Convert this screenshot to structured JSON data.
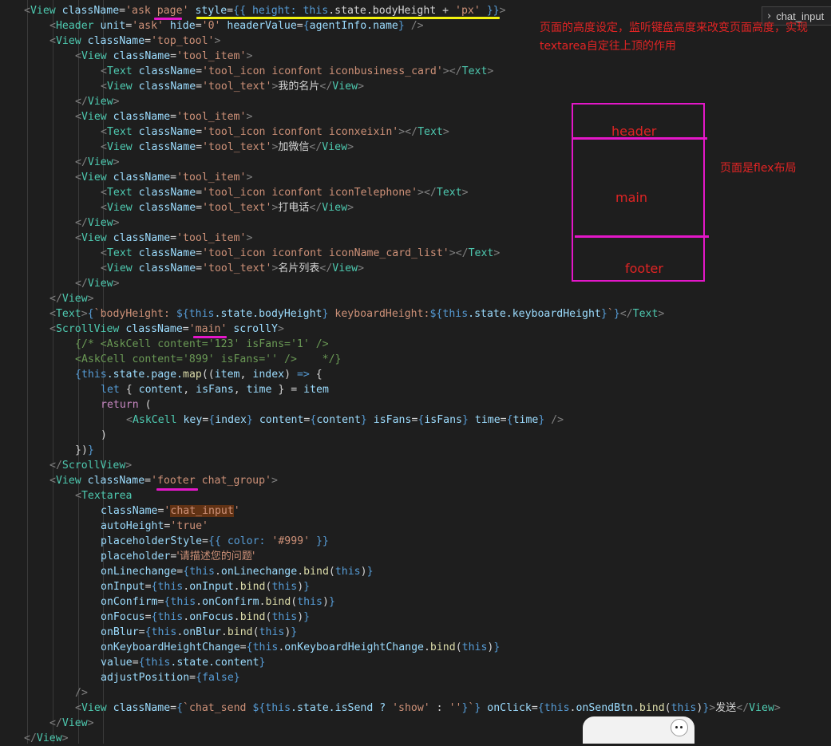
{
  "search_widget": {
    "chevron_icon": "chevron-right-icon",
    "query": "chat_input"
  },
  "code": {
    "l1": [
      "<",
      "View",
      " ",
      "className",
      "=",
      "'ask ",
      "page",
      "'",
      " ",
      "style",
      "=",
      "{{ height: ",
      "this",
      ".state.bodyHeight + ",
      "'px'",
      " }}",
      ">"
    ],
    "l2": [
      "<",
      "Header",
      " ",
      "unit",
      "=",
      "'ask'",
      " ",
      "hide",
      "=",
      "'0'",
      " ",
      "headerValue",
      "=",
      "{",
      "agentInfo.name",
      "}",
      " />"
    ],
    "l3": [
      "<",
      "View",
      " ",
      "className",
      "=",
      "'top_tool'",
      ">"
    ],
    "l4": [
      "<",
      "View",
      " ",
      "className",
      "=",
      "'tool_item'",
      ">"
    ],
    "l5": [
      "<",
      "Text",
      " ",
      "className",
      "=",
      "'tool_icon iconfont iconbusiness_card'",
      "></",
      "Text",
      ">"
    ],
    "l6": [
      "<",
      "View",
      " ",
      "className",
      "=",
      "'tool_text'",
      ">",
      "我的名片",
      "</",
      "View",
      ">"
    ],
    "l7": [
      "</",
      "View",
      ">"
    ],
    "l8": [
      "<",
      "View",
      " ",
      "className",
      "=",
      "'tool_item'",
      ">"
    ],
    "l9": [
      "<",
      "Text",
      " ",
      "className",
      "=",
      "'tool_icon iconfont iconxeixin'",
      "></",
      "Text",
      ">"
    ],
    "l10": [
      "<",
      "View",
      " ",
      "className",
      "=",
      "'tool_text'",
      ">",
      "加微信",
      "</",
      "View",
      ">"
    ],
    "l11": [
      "</",
      "View",
      ">"
    ],
    "l12": [
      "<",
      "View",
      " ",
      "className",
      "=",
      "'tool_item'",
      ">"
    ],
    "l13": [
      "<",
      "Text",
      " ",
      "className",
      "=",
      "'tool_icon iconfont iconTelephone'",
      "></",
      "Text",
      ">"
    ],
    "l14": [
      "<",
      "View",
      " ",
      "className",
      "=",
      "'tool_text'",
      ">",
      "打电话",
      "</",
      "View",
      ">"
    ],
    "l15": [
      "</",
      "View",
      ">"
    ],
    "l16": [
      "<",
      "View",
      " ",
      "className",
      "=",
      "'tool_item'",
      ">"
    ],
    "l17": [
      "<",
      "Text",
      " ",
      "className",
      "=",
      "'tool_icon iconfont iconName_card_list'",
      "></",
      "Text",
      ">"
    ],
    "l18": [
      "<",
      "View",
      " ",
      "className",
      "=",
      "'tool_text'",
      ">",
      "名片列表",
      "</",
      "View",
      ">"
    ],
    "l19": [
      "</",
      "View",
      ">"
    ],
    "l20": [
      "</",
      "View",
      ">"
    ],
    "l21": [
      "<",
      "Text",
      ">",
      "{",
      "`bodyHeight: ",
      "${",
      "this",
      ".state.bodyHeight",
      "}",
      " keyboardHeight:",
      "${",
      "this",
      ".state.keyboardHeight",
      "}",
      "`",
      "}",
      "</",
      "Text",
      ">"
    ],
    "l22": [
      "<",
      "ScrollView",
      " ",
      "className",
      "=",
      "'",
      "main",
      "'",
      " ",
      "scrollY",
      ">"
    ],
    "l23": [
      "{/* <AskCell content='123' isFans='1' />"
    ],
    "l24": [
      "<AskCell content='899' isFans='' />    */}"
    ],
    "l25": [
      "{",
      "this",
      ".state.page.",
      "map",
      "((",
      "item",
      ", ",
      "index",
      ") ",
      "=>",
      " {"
    ],
    "l26": [
      "let",
      " { ",
      "content",
      ", ",
      "isFans",
      ", ",
      "time",
      " } = ",
      "item"
    ],
    "l27": [
      "return",
      " ("
    ],
    "l28": [
      "<",
      "AskCell",
      " ",
      "key",
      "=",
      "{",
      "index",
      "}",
      " ",
      "content",
      "=",
      "{",
      "content",
      "}",
      " ",
      "isFans",
      "=",
      "{",
      "isFans",
      "}",
      " ",
      "time",
      "=",
      "{",
      "time",
      "}",
      " />"
    ],
    "l29": [
      ")"
    ],
    "l30": [
      "})",
      "}"
    ],
    "l31": [
      "</",
      "ScrollView",
      ">"
    ],
    "l32": [
      "<",
      "View",
      " ",
      "className",
      "=",
      "'",
      "footer",
      " chat_group'",
      ">"
    ],
    "l33": [
      "<",
      "Textarea"
    ],
    "l34": [
      "className",
      "=",
      "'",
      "chat_input",
      "'"
    ],
    "l35": [
      "autoHeight",
      "=",
      "'true'"
    ],
    "l36": [
      "placeholderStyle",
      "=",
      "{{ color: ",
      "'#999'",
      " }}"
    ],
    "l37": [
      "placeholder",
      "=",
      "'请描述您的问题'"
    ],
    "l38": [
      "onLinechange",
      "=",
      "{",
      "this",
      ".",
      "onLinechange",
      ".",
      "bind",
      "(",
      "this",
      ")",
      "}"
    ],
    "l39": [
      "onInput",
      "=",
      "{",
      "this",
      ".",
      "onInput",
      ".",
      "bind",
      "(",
      "this",
      ")",
      "}"
    ],
    "l40": [
      "onConfirm",
      "=",
      "{",
      "this",
      ".",
      "onConfirm",
      ".",
      "bind",
      "(",
      "this",
      ")",
      "}"
    ],
    "l41": [
      "onFocus",
      "=",
      "{",
      "this",
      ".",
      "onFocus",
      ".",
      "bind",
      "(",
      "this",
      ")",
      "}"
    ],
    "l42": [
      "onBlur",
      "=",
      "{",
      "this",
      ".",
      "onBlur",
      ".",
      "bind",
      "(",
      "this",
      ")",
      "}"
    ],
    "l43": [
      "onKeyboardHeightChange",
      "=",
      "{",
      "this",
      ".",
      "onKeyboardHeightChange",
      ".",
      "bind",
      "(",
      "this",
      ")",
      "}"
    ],
    "l44": [
      "value",
      "=",
      "{",
      "this",
      ".state.content",
      "}"
    ],
    "l45": [
      "adjustPosition",
      "=",
      "{",
      "false",
      "}"
    ],
    "l46": [
      "/>"
    ],
    "l47": [
      "<",
      "View",
      " ",
      "className",
      "=",
      "{",
      "`chat_send ",
      "${",
      "this",
      ".state.isSend ? ",
      "'show'",
      " : ",
      "''",
      "}",
      "`",
      "}",
      " ",
      "onClick",
      "=",
      "{",
      "this",
      ".",
      "onSendBtn",
      ".",
      "bind",
      "(",
      "this",
      ")",
      "}",
      ">",
      "发送",
      "</",
      "View",
      ">"
    ],
    "l48": [
      "</",
      "View",
      ">"
    ],
    "l49": [
      "</",
      "View",
      ">"
    ]
  },
  "annotations": {
    "top": "页面的高度设定，监听键盘高度来改变页面高度，实现textarea自定往上顶的作用",
    "side": "页面是flex布局",
    "diagram": {
      "header": "header",
      "main": "main",
      "footer": "footer"
    }
  },
  "colors": {
    "accent": "#e317c8",
    "note": "#e02424",
    "underline_style": "#f2f20f"
  }
}
